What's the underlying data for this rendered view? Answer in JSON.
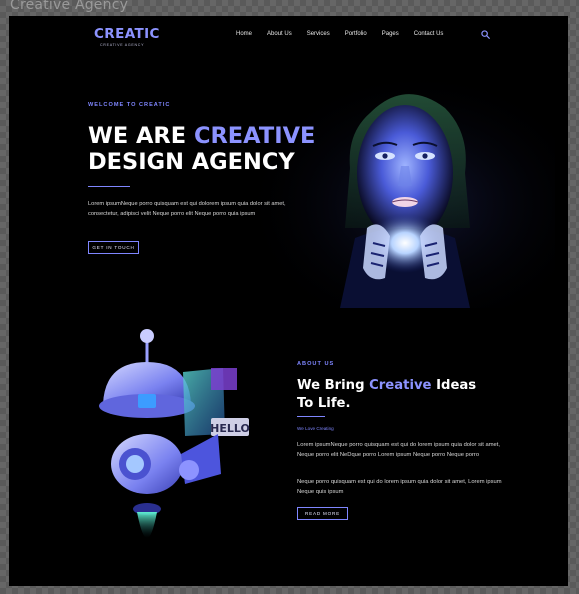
{
  "window": {
    "title": "Creative Agency"
  },
  "header": {
    "logo": {
      "name": "CREATIC",
      "tagline": "CREATIVE AGENCY"
    },
    "nav": [
      {
        "label": "Home"
      },
      {
        "label": "About Us"
      },
      {
        "label": "Services"
      },
      {
        "label": "Portfolio"
      },
      {
        "label": "Pages"
      },
      {
        "label": "Contact Us"
      }
    ],
    "search_icon": "search-icon"
  },
  "hero": {
    "eyebrow": "WELCOME TO CREATIC",
    "title_line1_part1": "WE ARE ",
    "title_line1_accent": "CREATIVE",
    "title_line2": "DESIGN AGENCY",
    "body": "Lorem ipsumNeque porro quisquam est qui dolorem ipsum quia dolor sit amet, consectetur, adipisci velit Neque porro elit Neque porro quia ipsum",
    "button": "GET IN TOUCH"
  },
  "about": {
    "eyebrow": "ABOUT US",
    "title_part1": "We Bring ",
    "title_accent": "Creative",
    "title_part2": " Ideas",
    "title_line2": "To Life.",
    "tagline": "We Love Creating",
    "paragraph1": "Lorem ipsumNeque porro quisquam est qui do lorem ipsum quia dolor sit amet, Neque porro elit NeDque porro Lorem ipsum Neque porro Neque porro",
    "paragraph2": "Neque porro quisquam est qui do lorem ipsum quia dolor sit amet, Lorem ipsum Neque quis ipsum",
    "button": "READ MORE",
    "illustration_text": "HELLO"
  },
  "colors": {
    "accent": "#8c93ff",
    "background": "#000000",
    "text": "#ffffff"
  }
}
